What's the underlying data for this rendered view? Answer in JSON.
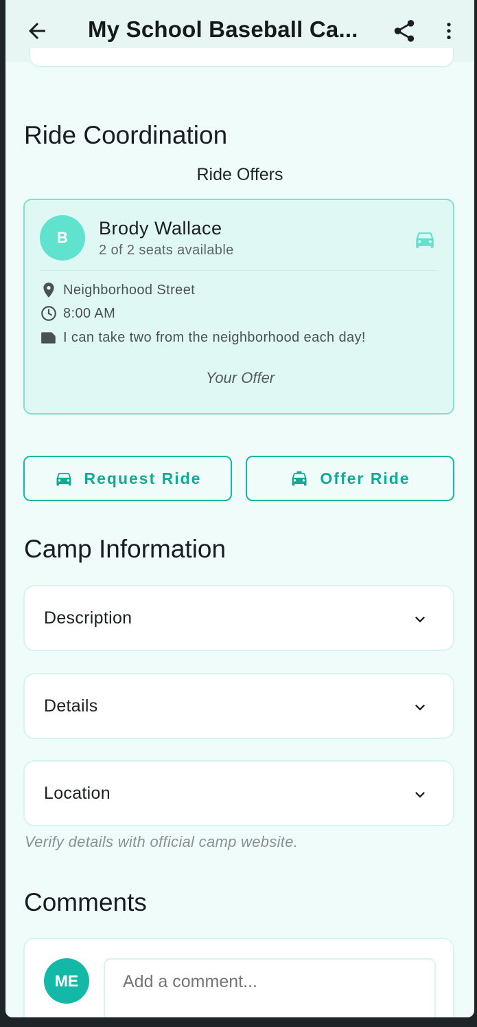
{
  "appbar": {
    "title": "My School Baseball Ca...",
    "back_icon": "arrow-back-icon",
    "share_icon": "share-icon",
    "more_icon": "more-vertical-icon"
  },
  "ride": {
    "section_title": "Ride Coordination",
    "offers_heading": "Ride Offers",
    "offer": {
      "avatar_initial": "B",
      "name": "Brody Wallace",
      "seats": "2 of 2 seats available",
      "location": "Neighborhood Street",
      "time": "8:00 AM",
      "note": "I can take two from the neighborhood each day!",
      "badge": "Your Offer"
    },
    "request_button": "Request Ride",
    "offer_button": "Offer Ride"
  },
  "camp": {
    "section_title": "Camp Information",
    "accordion": [
      "Description",
      "Details",
      "Location"
    ],
    "disclaimer": "Verify details with official camp website."
  },
  "comments": {
    "section_title": "Comments",
    "avatar_initials": "ME",
    "placeholder": "Add a comment..."
  },
  "colors": {
    "accent": "#14b8a6",
    "accent_light": "#5fe3cf",
    "background": "#effcf9"
  }
}
